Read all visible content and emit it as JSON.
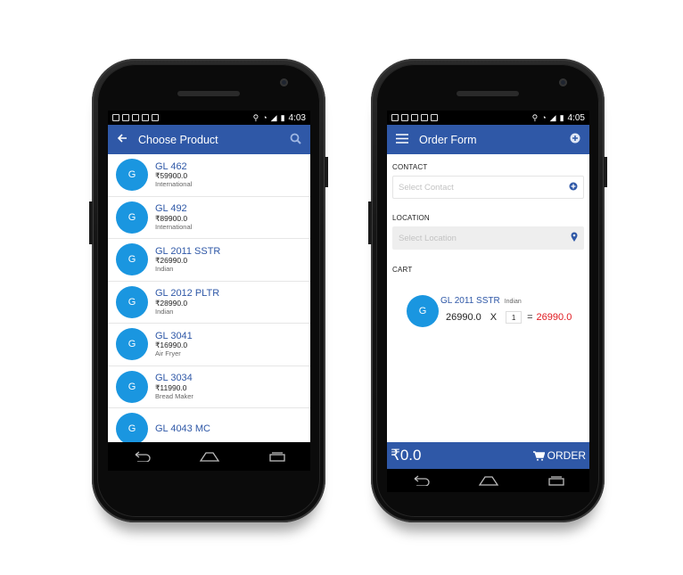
{
  "left_phone": {
    "status_time": "4:03",
    "title": "Choose Product",
    "products": [
      {
        "avatar": "G",
        "name": "GL 462",
        "price": "₹59900.0",
        "category": "International"
      },
      {
        "avatar": "G",
        "name": "GL 492",
        "price": "₹89900.0",
        "category": "International"
      },
      {
        "avatar": "G",
        "name": "GL 2011 SSTR",
        "price": "₹26990.0",
        "category": "Indian"
      },
      {
        "avatar": "G",
        "name": "GL 2012 PLTR",
        "price": "₹28990.0",
        "category": "Indian"
      },
      {
        "avatar": "G",
        "name": "GL 3041",
        "price": "₹16990.0",
        "category": "Air Fryer"
      },
      {
        "avatar": "G",
        "name": "GL 3034",
        "price": "₹11990.0",
        "category": "Bread Maker"
      },
      {
        "avatar": "G",
        "name": "GL 4043 MC",
        "price": "",
        "category": ""
      }
    ]
  },
  "right_phone": {
    "status_time": "4:05",
    "title": "Order Form",
    "contact_label": "CONTACT",
    "contact_placeholder": "Select Contact",
    "location_label": "LOCATION",
    "location_placeholder": "Select Location",
    "cart_label": "CART",
    "cart_item": {
      "avatar": "G",
      "name": "GL 2011 SSTR",
      "category": "Indian",
      "unit_price": "26990.0",
      "times": "X",
      "qty": "1",
      "equals": "=",
      "total": "26990.0"
    },
    "footer_amount": "₹0.0",
    "order_button": "ORDER"
  },
  "colors": {
    "primary": "#2f58a7",
    "avatar": "#1a96e0",
    "total_red": "#e0191f"
  },
  "icons": [
    "back-arrow-icon",
    "search-icon",
    "menu-icon",
    "add-circle-icon",
    "map-marker-icon",
    "cart-icon",
    "nav-back-icon",
    "nav-home-icon",
    "nav-recents-icon"
  ]
}
